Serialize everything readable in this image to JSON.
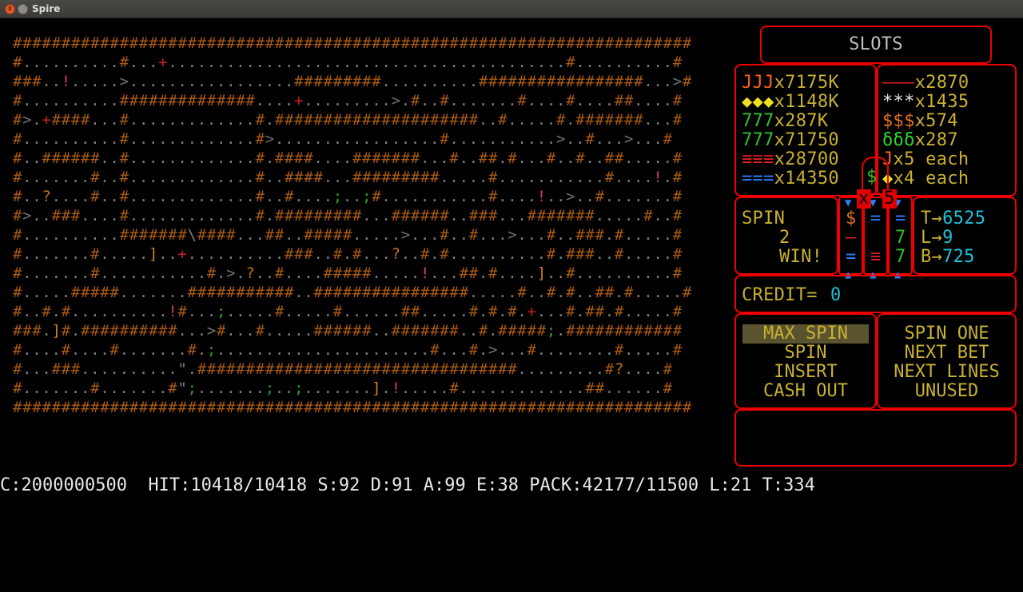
{
  "window": {
    "title": "Spire",
    "close_glyph": "x"
  },
  "colors": {
    "wall": "#a85a14",
    "bright_wall": "#e08a2a",
    "floor": "#808080",
    "panel_border": "#e00000",
    "text_yellow": "#c8b030",
    "text_cyan": "#20c0d8",
    "text_green": "#30c030",
    "text_red": "#e02020",
    "text_white": "#e8e8e8"
  },
  "map": {
    "grid_cols": 70,
    "grid_rows": 21,
    "rows": [
      "######################################################################",
      "#..........#...+.........................................#..........#",
      "###..!.....>.................#########..........#################...>#",
      "#..........##############....+.........>.#..#.......#....#....##....#",
      "#>.+####...#.............#.#####################..#.....#.#######...#",
      "#..........#.............#>.................#...........>..#...>...#",
      "#..######..#.............#.####....#######...#..##.#...#..#..##.....#",
      "#.......#..#.............#..####...#########.....#...........#....!.#",
      "#..?....#..#.............#..#....;..;#...........#....!..>..#.......#",
      "#>..###....#.............#.#########...######..###...#######.....#..#",
      "#..........#######\\####...##..#####.....>...#..#...>...#..###.#.....#",
      "#.......#.....]..+..........###..#.#...?..#.#..........#.###..#.....#",
      "#.......#...........#.>.?..#....#####.....!...##.#....]..#..........#",
      "#.....#####.......###########..################.....#..#.#..##.#.....#",
      "#..#.#..........!#...;.....#.....#......##.....#.#.#.+...#.##.#.....#",
      "###.]#.##########...>#...#.....######..#######..#.#####;.############",
      "#....#....#.......#.;......................#...#.>...#........#.....#",
      "#...###..........\".#################################.........#?....#",
      "#.......#.......#\";.......;..;.......].!.....#.............##......#",
      "######################################################################",
      "                                                                      "
    ],
    "room_glyphs": [
      {
        "glyph": "◆",
        "color": "#30d070",
        "name": "gem-green"
      },
      {
        "glyph": "$",
        "color": "#2aa0ff",
        "name": "gold-blue"
      },
      {
        "glyph": "◆",
        "color": "#30d8e0",
        "name": "gem-cyan"
      },
      {
        "glyph": "$",
        "color": "#c0a030",
        "name": "gold-yellow"
      },
      {
        "glyph": "$",
        "color": "#30c060",
        "name": "gold-green"
      },
      {
        "glyph": "◆",
        "color": "#f07080",
        "name": "gem-pink"
      },
      {
        "glyph": "◆",
        "color": "#d02020",
        "name": "gem-red"
      },
      {
        "glyph": "◆",
        "color": "#2a80ff",
        "name": "gem-blue"
      },
      {
        "glyph": "@",
        "color": "#c8c8c8",
        "name": "player"
      },
      {
        "glyph": "◆",
        "color": "#30d070",
        "name": "gem-green-2"
      },
      {
        "glyph": "$",
        "color": "#20b0c0",
        "name": "gold-cyan"
      },
      {
        "glyph": "◆",
        "color": "#e07020",
        "name": "gem-orange"
      }
    ]
  },
  "slots": {
    "title": "SLOTS",
    "payouts_left": [
      {
        "sym": "JJJ",
        "sym_color": "#ff6020",
        "mult": "x7175K"
      },
      {
        "sym": "◆◆◆",
        "sym_color": "#f0e020",
        "mult": "x1148K"
      },
      {
        "sym": "777",
        "sym_color": "#30c030",
        "mult": "x287K"
      },
      {
        "sym": "777",
        "sym_color": "#30c030",
        "mult": "x71750"
      },
      {
        "sym": "≡≡≡",
        "sym_color": "#e02020",
        "mult": "x28700"
      },
      {
        "sym": "===",
        "sym_color": "#2a80ff",
        "mult": "x14350"
      }
    ],
    "payouts_right": [
      {
        "sym": "———",
        "sym_color": "#e02020",
        "mult": "x2870"
      },
      {
        "sym": "***",
        "sym_color": "#e8e8e8",
        "mult": "x1435"
      },
      {
        "sym": "$$$",
        "sym_color": "#e07020",
        "mult": "x574"
      },
      {
        "sym": "δδδ",
        "sym_color": "#30d030",
        "mult": "x287"
      },
      {
        "sym": "J",
        "sym_color": "#ff6020",
        "mult": "x5 each"
      },
      {
        "sym": "◆",
        "sym_color": "#f0e020",
        "mult": "x4 each"
      }
    ],
    "center_sym": "$",
    "spin_label": "SPIN",
    "spin_count": "2",
    "win_label": "WIN!",
    "reels": [
      [
        "$",
        "—",
        "="
      ],
      [
        "=",
        "",
        "≡"
      ],
      [
        "=",
        "7",
        "7"
      ]
    ],
    "reel_colors": [
      [
        "#e07020",
        "#e02020",
        "#2a80ff"
      ],
      [
        "#2a80ff",
        "#e02020",
        "#e02020"
      ],
      [
        "#2a80ff",
        "#30c030",
        "#30c030"
      ]
    ],
    "counters": [
      {
        "label": "T",
        "value": "6525"
      },
      {
        "label": "L",
        "value": "9"
      },
      {
        "label": "B",
        "value": "725"
      }
    ],
    "credit_label": "CREDIT=",
    "credit_value": "0",
    "menu_left": [
      "MAX SPIN",
      "SPIN",
      "INSERT",
      "CASH OUT"
    ],
    "menu_right": [
      "SPIN ONE",
      "NEXT BET",
      "NEXT LINES",
      "UNUSED"
    ],
    "selected_menu": "MAX SPIN",
    "mark_x": "x",
    "mark_5": "5"
  },
  "status": {
    "text": "C:2000000500  HIT:10418/10418 S:92 D:91 A:99 E:38 PACK:42177/11500 L:21 T:334"
  }
}
